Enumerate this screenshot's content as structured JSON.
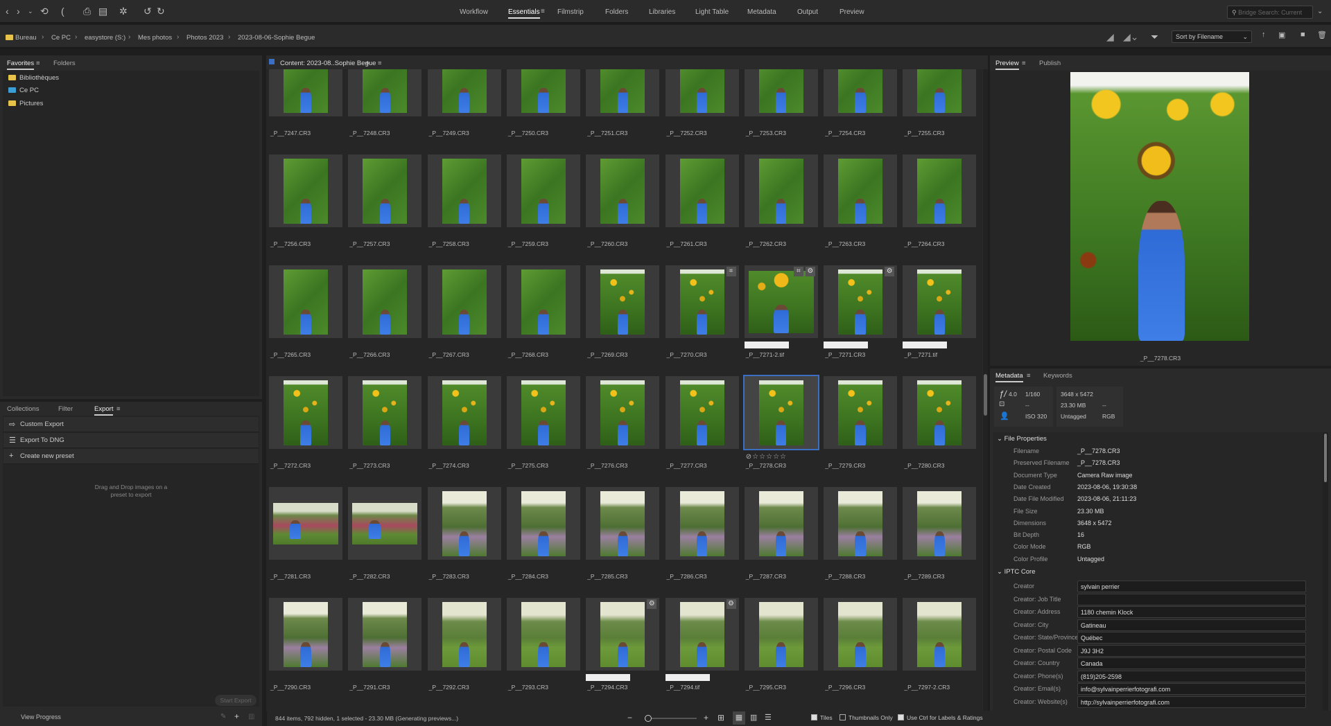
{
  "toolbar": {
    "workspaces": [
      "Workflow",
      "Essentials",
      "Filmstrip",
      "Folders",
      "Libraries",
      "Light Table",
      "Metadata",
      "Output",
      "Preview"
    ],
    "active_workspace": "Essentials",
    "search_placeholder": "Bridge Search: Current"
  },
  "breadcrumb": [
    "Bureau",
    "Ce PC",
    "easystore (S:)",
    "Mes photos",
    "Photos 2023",
    "2023-08-06-Sophie Begue"
  ],
  "sort": {
    "label": "Sort by Filename"
  },
  "left_top": {
    "tabs": [
      "Favorites",
      "Folders"
    ],
    "items": [
      "Bibliothèques",
      "Ce PC",
      "Pictures"
    ]
  },
  "left_bottom": {
    "tabs": [
      "Collections",
      "Filter",
      "Export"
    ],
    "items": [
      "Custom Export",
      "Export To DNG",
      "Create new preset"
    ],
    "drop_hint_1": "Drag and Drop images on a",
    "drop_hint_2": "preset to export",
    "start_export": "Start Export",
    "view_progress": "View Progress"
  },
  "content": {
    "title": "Content: 2023-08..Sophie Begue",
    "rows": [
      [
        {
          "n": "_P__7247.CR3"
        },
        {
          "n": "_P__7248.CR3"
        },
        {
          "n": "_P__7249.CR3"
        },
        {
          "n": "_P__7250.CR3"
        },
        {
          "n": "_P__7251.CR3"
        },
        {
          "n": "_P__7252.CR3"
        },
        {
          "n": "_P__7253.CR3"
        },
        {
          "n": "_P__7254.CR3"
        },
        {
          "n": "_P__7255.CR3"
        }
      ],
      [
        {
          "n": "_P__7256.CR3"
        },
        {
          "n": "_P__7257.CR3"
        },
        {
          "n": "_P__7258.CR3"
        },
        {
          "n": "_P__7259.CR3"
        },
        {
          "n": "_P__7260.CR3"
        },
        {
          "n": "_P__7261.CR3"
        },
        {
          "n": "_P__7262.CR3"
        },
        {
          "n": "_P__7263.CR3"
        },
        {
          "n": "_P__7264.CR3"
        }
      ],
      [
        {
          "n": "_P__7265.CR3"
        },
        {
          "n": "_P__7266.CR3"
        },
        {
          "n": "_P__7267.CR3"
        },
        {
          "n": "_P__7268.CR3"
        },
        {
          "n": "_P__7269.CR3",
          "v": "sun"
        },
        {
          "n": "_P__7270.CR3",
          "v": "sun",
          "crop": true
        },
        {
          "n": "_P__7271-2.tif",
          "v": "close",
          "crop": true,
          "adj": true,
          "label": true
        },
        {
          "n": "_P__7271.CR3",
          "v": "sun",
          "adj": true,
          "label": true
        },
        {
          "n": "_P__7271.tif",
          "v": "sun",
          "label": true
        }
      ],
      [
        {
          "n": "_P__7272.CR3",
          "v": "sun"
        },
        {
          "n": "_P__7273.CR3",
          "v": "sun"
        },
        {
          "n": "_P__7274.CR3",
          "v": "sun"
        },
        {
          "n": "_P__7275.CR3",
          "v": "sun"
        },
        {
          "n": "_P__7276.CR3",
          "v": "sun"
        },
        {
          "n": "_P__7277.CR3",
          "v": "sun"
        },
        {
          "n": "_P__7278.CR3",
          "v": "sun",
          "selected": true,
          "rating": "⊘☆☆☆☆☆"
        },
        {
          "n": "_P__7279.CR3",
          "v": "sun"
        },
        {
          "n": "_P__7280.CR3",
          "v": "sun"
        }
      ],
      [
        {
          "n": "_P__7281.CR3",
          "v": "land"
        },
        {
          "n": "_P__7282.CR3",
          "v": "land"
        },
        {
          "n": "_P__7283.CR3",
          "v": "garden"
        },
        {
          "n": "_P__7284.CR3",
          "v": "garden"
        },
        {
          "n": "_P__7285.CR3",
          "v": "garden"
        },
        {
          "n": "_P__7286.CR3",
          "v": "garden"
        },
        {
          "n": "_P__7287.CR3",
          "v": "garden"
        },
        {
          "n": "_P__7288.CR3",
          "v": "garden"
        },
        {
          "n": "_P__7289.CR3",
          "v": "garden"
        }
      ],
      [
        {
          "n": "_P__7290.CR3",
          "v": "garden"
        },
        {
          "n": "_P__7291.CR3",
          "v": "garden"
        },
        {
          "n": "_P__7292.CR3",
          "v": "sit"
        },
        {
          "n": "_P__7293.CR3",
          "v": "sit"
        },
        {
          "n": "_P__7294.CR3",
          "v": "sit",
          "adj": true,
          "label": true
        },
        {
          "n": "_P__7294.tif",
          "v": "sit",
          "adj": true,
          "label": true
        },
        {
          "n": "_P__7295.CR3",
          "v": "sit"
        },
        {
          "n": "_P__7296.CR3",
          "v": "sit"
        },
        {
          "n": "_P__7297-2.CR3",
          "v": "sit"
        }
      ]
    ]
  },
  "preview": {
    "tabs": [
      "Preview",
      "Publish"
    ],
    "caption": "_P__7278.CR3"
  },
  "metadata": {
    "tabs": [
      "Metadata",
      "Keywords"
    ],
    "quick": {
      "aperture": "4.0",
      "shutter": "1/160",
      "metering": "--",
      "iso": "320",
      "dimensions": "3648 x 5472",
      "size": "23.30 MB",
      "resolution": "--",
      "profile": "Untagged",
      "mode": "RGB"
    },
    "file_properties_title": "File Properties",
    "file_properties": [
      [
        "Filename",
        "_P__7278.CR3"
      ],
      [
        "Preserved Filename",
        "_P__7278.CR3"
      ],
      [
        "Document Type",
        "Camera Raw image"
      ],
      [
        "Date Created",
        "2023-08-06, 19:30:38"
      ],
      [
        "Date File Modified",
        "2023-08-06, 21:11:23"
      ],
      [
        "File Size",
        "23.30 MB"
      ],
      [
        "Dimensions",
        "3648 x 5472"
      ],
      [
        "Bit Depth",
        "16"
      ],
      [
        "Color Mode",
        "RGB"
      ],
      [
        "Color Profile",
        "Untagged"
      ]
    ],
    "iptc_title": "IPTC Core",
    "iptc": [
      [
        "Creator",
        "sylvain perrier"
      ],
      [
        "Creator: Job Title",
        ""
      ],
      [
        "Creator: Address",
        "1180 chemin Klock"
      ],
      [
        "Creator: City",
        "Gatineau"
      ],
      [
        "Creator: State/Province",
        "Québec"
      ],
      [
        "Creator: Postal Code",
        "J9J 3H2"
      ],
      [
        "Creator: Country",
        "Canada"
      ],
      [
        "Creator: Phone(s)",
        "(819)205-2598"
      ],
      [
        "Creator: Email(s)",
        "info@sylvainperrierfotografi.com"
      ],
      [
        "Creator: Website(s)",
        "http://sylvainperrierfotografi.com"
      ]
    ]
  },
  "status": {
    "text": "844 items, 792 hidden, 1 selected - 23.30 MB (Generating previews...)",
    "tiles": "Tiles",
    "thumbs_only": "Thumbnails Only",
    "ctrl_labels": "Use Ctrl for Labels & Ratings",
    "tiles_checked": true,
    "thumbs_only_checked": false,
    "ctrl_checked": true
  },
  "colors": {
    "accent": "#3a6fc4",
    "folder": "#e8c34a",
    "background": "#2a2a2a"
  }
}
